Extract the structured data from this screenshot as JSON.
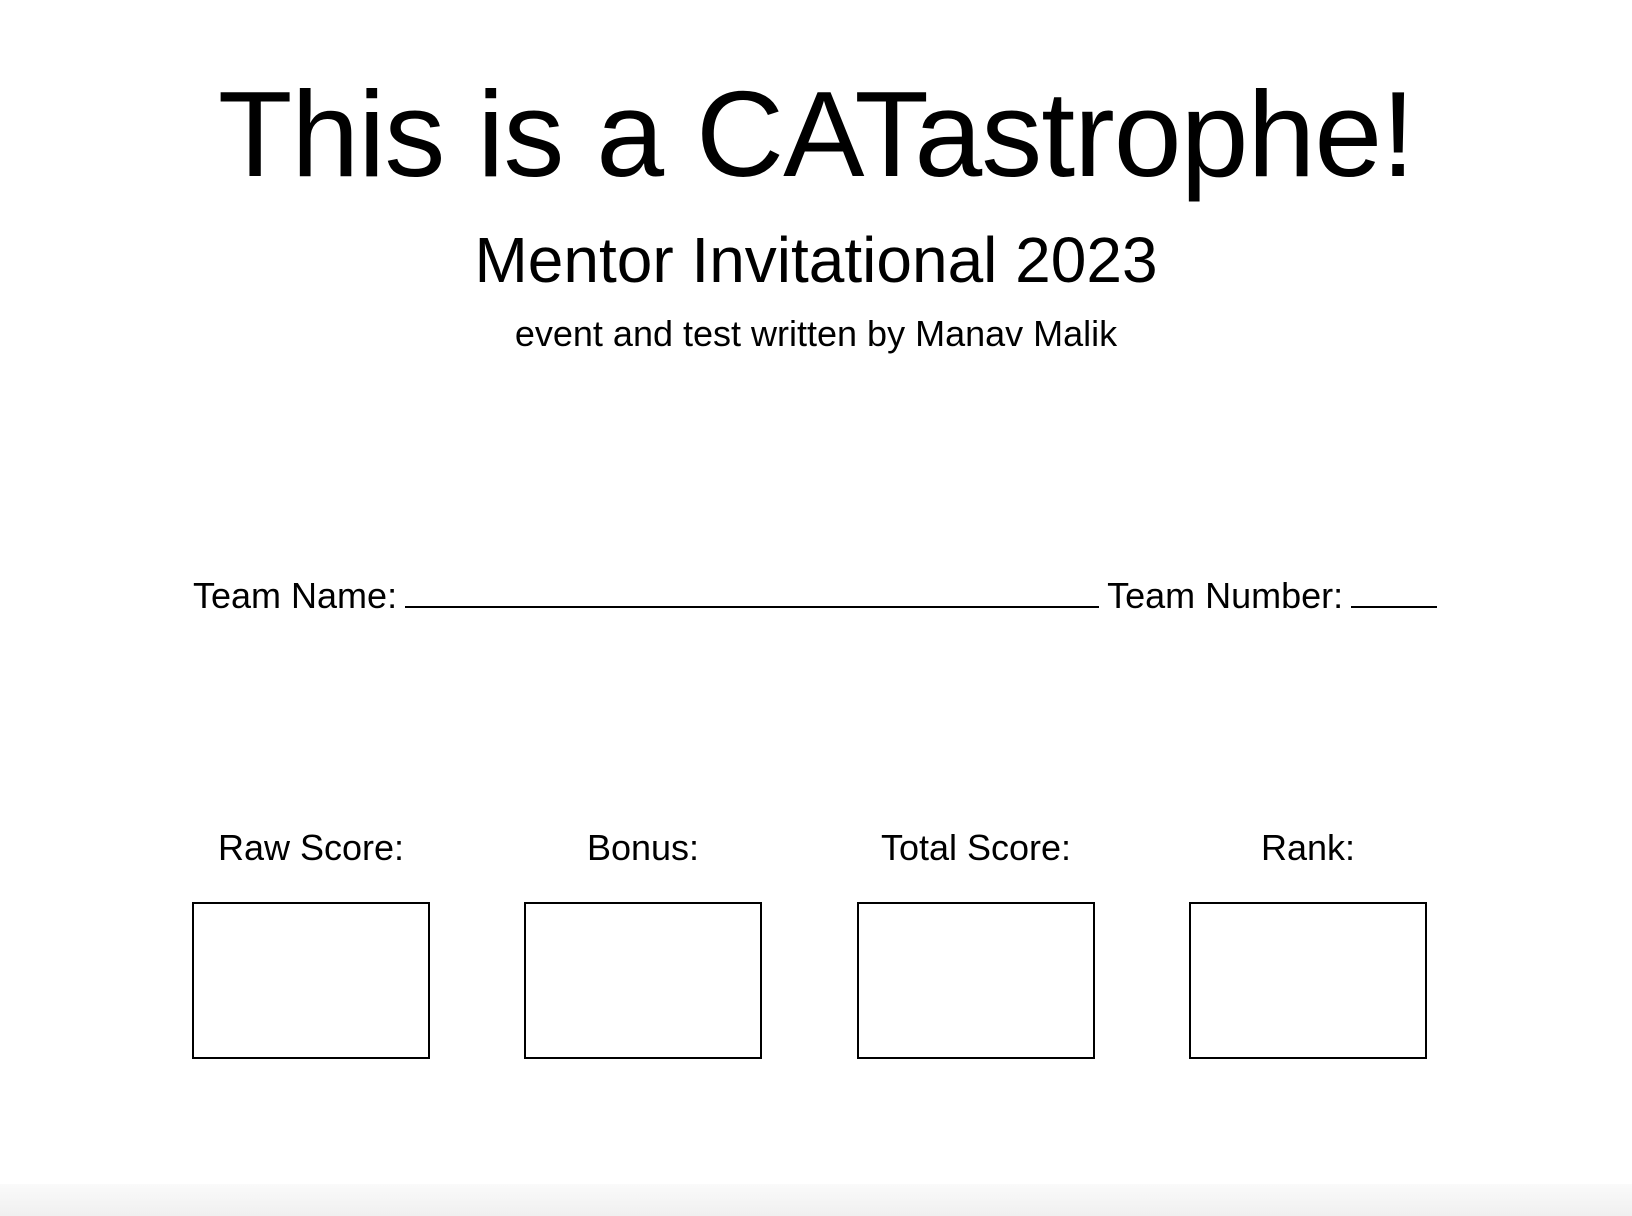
{
  "header": {
    "title": "This is a CATastrophe!",
    "subtitle": "Mentor Invitational 2023",
    "author": "event and test written by Manav Malik"
  },
  "team": {
    "name_label": "Team Name:",
    "number_label": "Team Number:"
  },
  "scores": [
    {
      "label": "Raw Score:"
    },
    {
      "label": "Bonus:"
    },
    {
      "label": "Total Score:"
    },
    {
      "label": "Rank:"
    }
  ]
}
